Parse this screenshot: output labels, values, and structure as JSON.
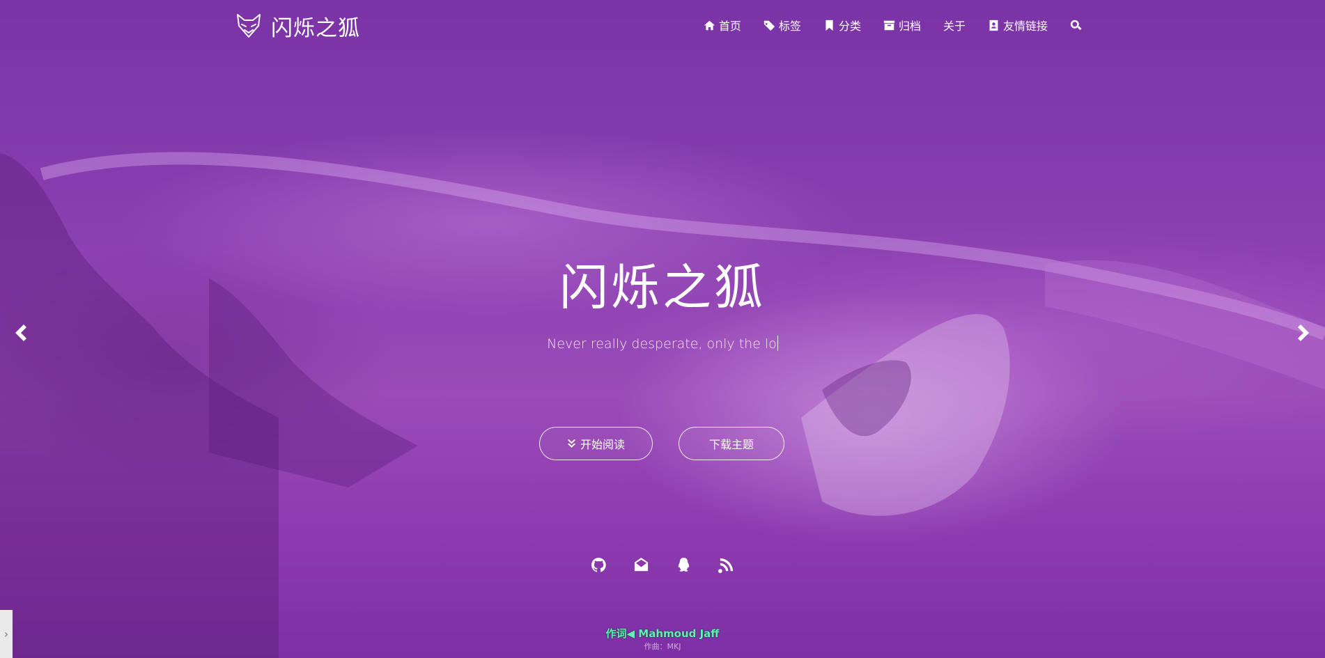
{
  "brand": {
    "title": "闪烁之狐"
  },
  "nav": {
    "items": [
      {
        "label": "首页",
        "icon": "home-icon"
      },
      {
        "label": "标签",
        "icon": "tags-icon"
      },
      {
        "label": "分类",
        "icon": "bookmark-icon"
      },
      {
        "label": "归档",
        "icon": "archive-icon"
      },
      {
        "label": "关于",
        "icon": ""
      },
      {
        "label": "友情链接",
        "icon": "address-card-icon"
      }
    ],
    "search_icon": "search-icon"
  },
  "hero": {
    "title": "闪烁之狐",
    "subtitle": "Never really desperate, only the lo",
    "read_button": "开始阅读",
    "download_button": "下载主题"
  },
  "social": [
    "github-icon",
    "email-icon",
    "qq-icon",
    "rss-icon"
  ],
  "lyrics": {
    "line": "作词◀ Mahmoud Jaff",
    "sub": "作曲：MKJ"
  },
  "colors": {
    "overlay": "#7b2fa0",
    "lyric": "#63f0b8"
  }
}
